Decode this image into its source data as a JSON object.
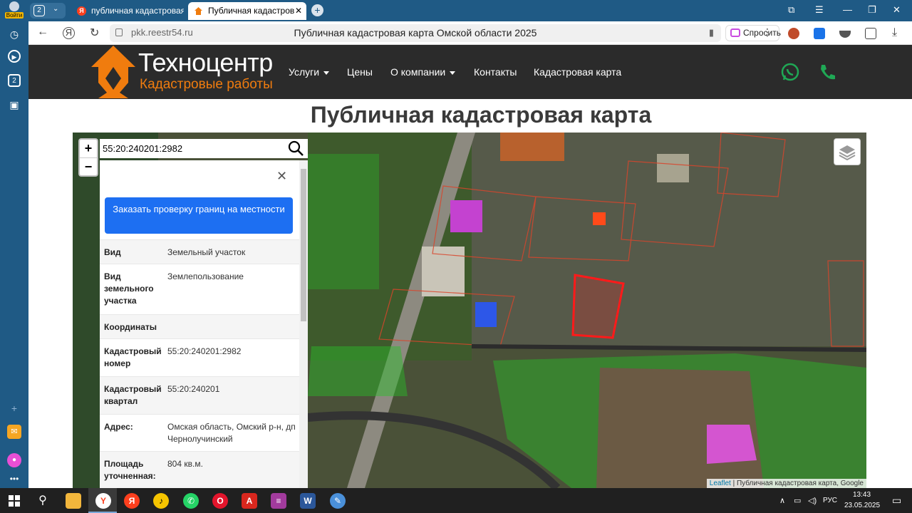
{
  "browser": {
    "sidebar": {
      "login_label": "Войти",
      "tab_badge": "2"
    },
    "tabs_count": "2",
    "tabs": [
      {
        "title": "публичная кадастровая ка"
      },
      {
        "title": "Публичная кадастров"
      }
    ],
    "address": {
      "url": "pkk.reestr54.ru",
      "page_title": "Публичная кадастровая карта Омской области 2025",
      "ask_label": "Спросить"
    }
  },
  "site": {
    "logo": {
      "title": "Техноцентр",
      "subtitle": "Кадастровые работы"
    },
    "nav": [
      {
        "label": "Услуги",
        "dropdown": true
      },
      {
        "label": "Цены",
        "dropdown": false
      },
      {
        "label": "О компании",
        "dropdown": true
      },
      {
        "label": "Контакты",
        "dropdown": false
      },
      {
        "label": "Кадастровая карта",
        "dropdown": false
      }
    ],
    "colors": {
      "accent": "#f07c0e",
      "header_bg": "#2b2b2b",
      "whatsapp": "#1fa855",
      "phone": "#1fa855"
    }
  },
  "page": {
    "title": "Публичная кадастровая карта"
  },
  "map": {
    "zoom_in": "+",
    "zoom_out": "−",
    "search_value": "55:20:240201:2982",
    "attribution_link": "Leaflet",
    "attribution_text": "| Публичная кадастровая карта, Google",
    "panel": {
      "order_button": "Заказать проверку границ на местности",
      "rows": [
        {
          "key": "Вид",
          "value": "Земельный участок"
        },
        {
          "key": "Вид земельного участка",
          "value": "Землепользование"
        },
        {
          "key": "Координаты",
          "value": ""
        },
        {
          "key": "Кадастровый номер",
          "value": "55:20:240201:2982"
        },
        {
          "key": "Кадастровый квартал",
          "value": "55:20:240201"
        },
        {
          "key": "Адрес:",
          "value": "Омская область, Омский р-н, дп Чернолучинский"
        },
        {
          "key": "Площадь уточненная:",
          "value": "804 кв.м."
        }
      ]
    }
  },
  "taskbar": {
    "language": "РУС",
    "time": "13:43",
    "date": "23.05.2025"
  }
}
